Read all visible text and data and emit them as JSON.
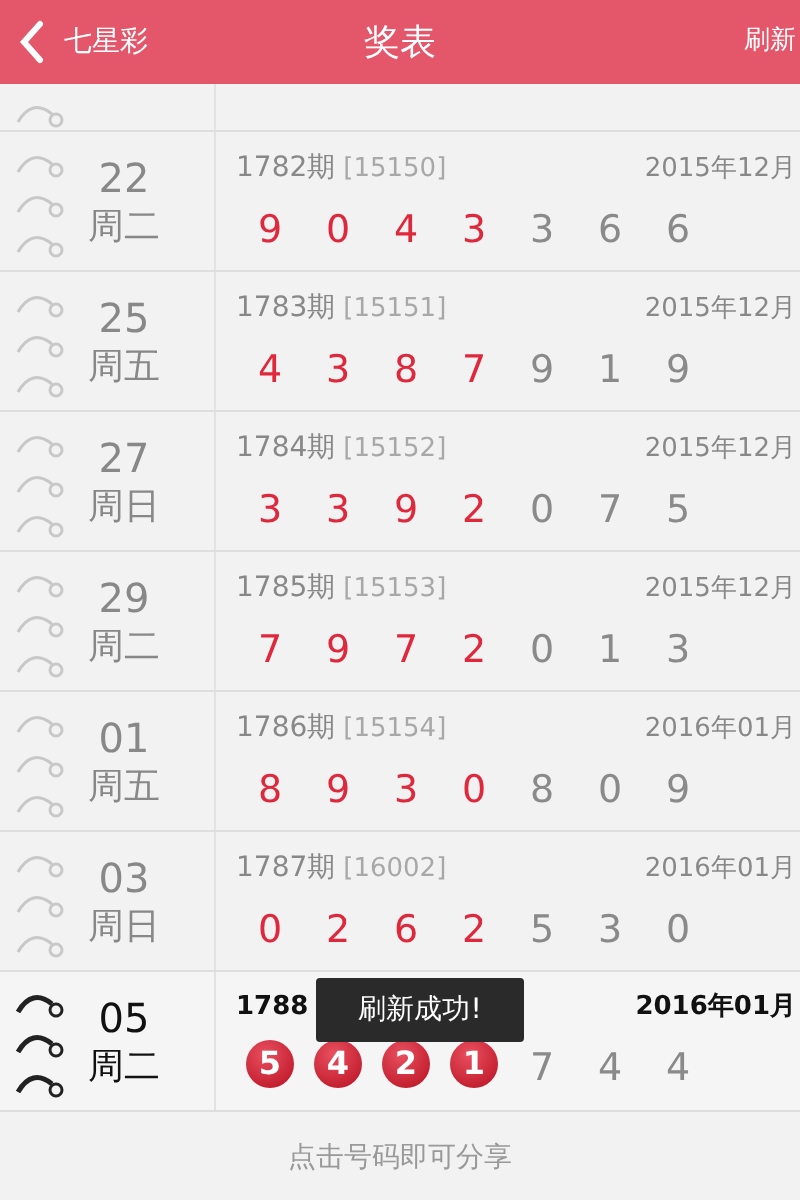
{
  "header": {
    "back_label": "七星彩",
    "title": "奖表",
    "action": "刷新"
  },
  "rows": [
    {
      "day": "22",
      "weekday": "周二",
      "issue": "1782期",
      "code": "[15150]",
      "date": "2015年12月",
      "main": [
        "9",
        "0",
        "4",
        "3"
      ],
      "extra": [
        "3",
        "6",
        "6"
      ],
      "latest": false
    },
    {
      "day": "25",
      "weekday": "周五",
      "issue": "1783期",
      "code": "[15151]",
      "date": "2015年12月",
      "main": [
        "4",
        "3",
        "8",
        "7"
      ],
      "extra": [
        "9",
        "1",
        "9"
      ],
      "latest": false
    },
    {
      "day": "27",
      "weekday": "周日",
      "issue": "1784期",
      "code": "[15152]",
      "date": "2015年12月",
      "main": [
        "3",
        "3",
        "9",
        "2"
      ],
      "extra": [
        "0",
        "7",
        "5"
      ],
      "latest": false
    },
    {
      "day": "29",
      "weekday": "周二",
      "issue": "1785期",
      "code": "[15153]",
      "date": "2015年12月",
      "main": [
        "7",
        "9",
        "7",
        "2"
      ],
      "extra": [
        "0",
        "1",
        "3"
      ],
      "latest": false
    },
    {
      "day": "01",
      "weekday": "周五",
      "issue": "1786期",
      "code": "[15154]",
      "date": "2016年01月",
      "main": [
        "8",
        "9",
        "3",
        "0"
      ],
      "extra": [
        "8",
        "0",
        "9"
      ],
      "latest": false
    },
    {
      "day": "03",
      "weekday": "周日",
      "issue": "1787期",
      "code": "[16002]",
      "date": "2016年01月",
      "main": [
        "0",
        "2",
        "6",
        "2"
      ],
      "extra": [
        "5",
        "3",
        "0"
      ],
      "latest": false
    },
    {
      "day": "05",
      "weekday": "周二",
      "issue": "1788",
      "date": "2016年01月",
      "main": [
        "5",
        "4",
        "2",
        "1"
      ],
      "extra": [
        "7",
        "4",
        "4"
      ],
      "latest": true
    }
  ],
  "footer": "点击号码即可分享",
  "toast": "刷新成功!"
}
